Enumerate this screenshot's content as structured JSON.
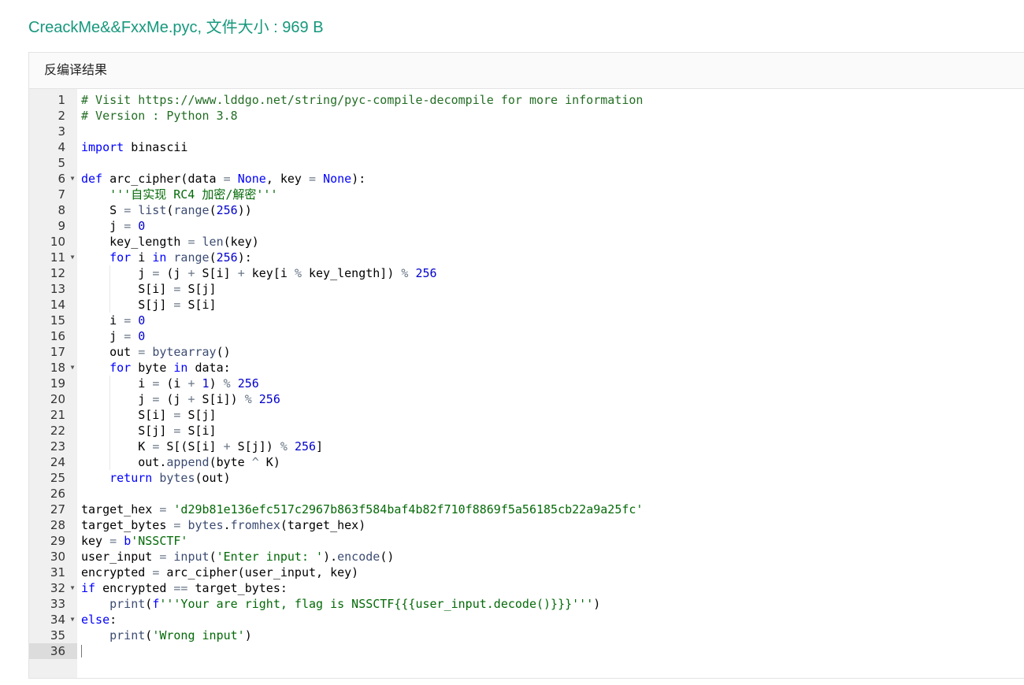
{
  "file_title": "CreackMe&&FxxMe.pyc, 文件大小 : 969 B",
  "panel": {
    "title": "反编译结果"
  },
  "editor": {
    "active_line": 36,
    "folded_lines": [
      6,
      11,
      18,
      32,
      34
    ],
    "lines": [
      "# Visit https://www.lddgo.net/string/pyc-compile-decompile for more information",
      "# Version : Python 3.8",
      "",
      "import binascii",
      "",
      "def arc_cipher(data = None, key = None):",
      "    '''自实现 RC4 加密/解密'''",
      "    S = list(range(256))",
      "    j = 0",
      "    key_length = len(key)",
      "    for i in range(256):",
      "        j = (j + S[i] + key[i % key_length]) % 256",
      "        S[i] = S[j]",
      "        S[j] = S[i]",
      "    i = 0",
      "    j = 0",
      "    out = bytearray()",
      "    for byte in data:",
      "        i = (i + 1) % 256",
      "        j = (j + S[i]) % 256",
      "        S[i] = S[j]",
      "        S[j] = S[i]",
      "        K = S[(S[i] + S[j]) % 256]",
      "        out.append(byte ^ K)",
      "    return bytes(out)",
      "",
      "target_hex = 'd29b81e136efc517c2967b863f584baf4b82f710f8869f5a56185cb22a9a25fc'",
      "target_bytes = bytes.fromhex(target_hex)",
      "key = b'NSSCTF'",
      "user_input = input('Enter input: ').encode()",
      "encrypted = arc_cipher(user_input, key)",
      "if encrypted == target_bytes:",
      "    print(f'''Your are right, flag is NSSCTF{{{user_input.decode()}}}''')",
      "else:",
      "    print('Wrong input')",
      ""
    ]
  }
}
